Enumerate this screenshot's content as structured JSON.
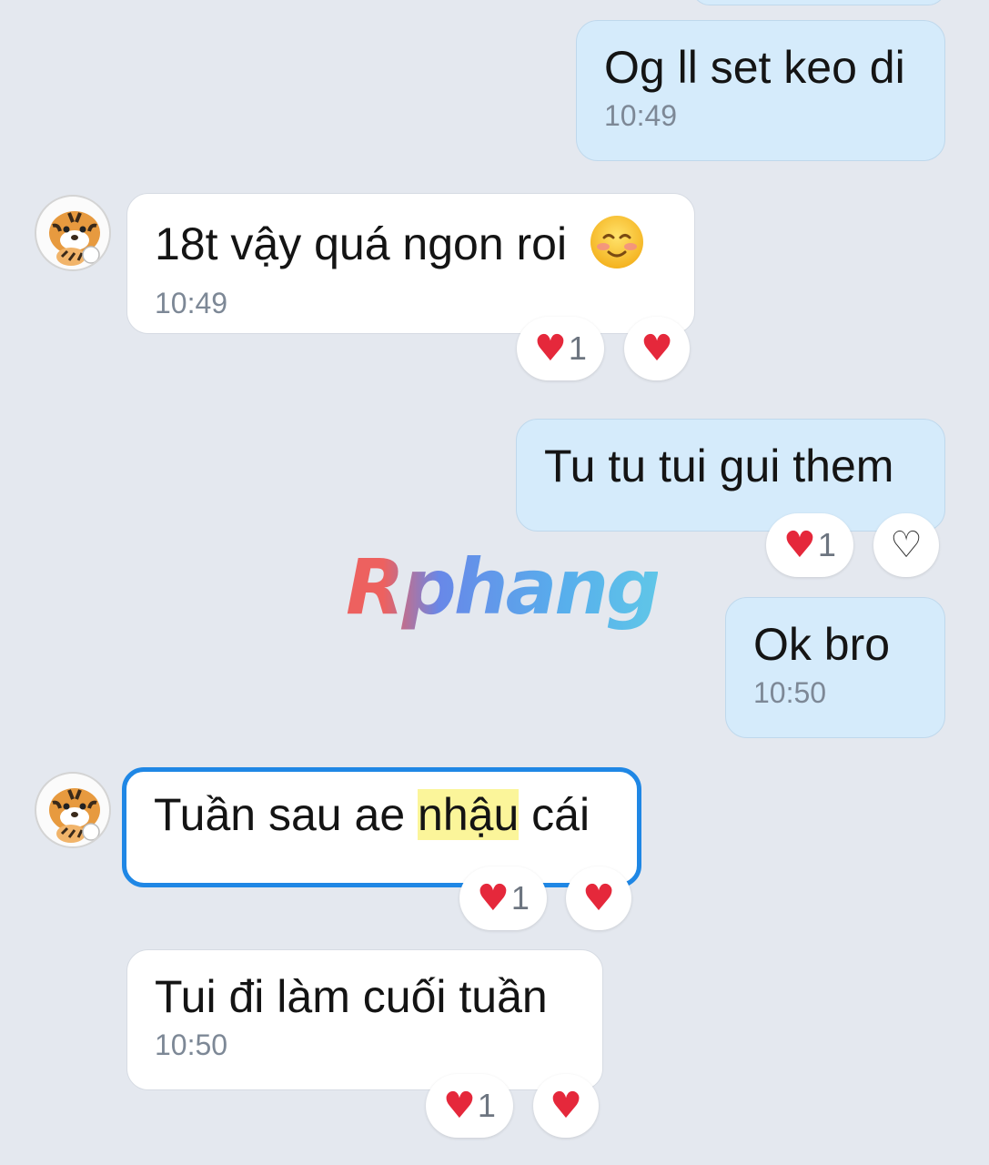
{
  "messages": [
    {
      "text": "Og ll set keo di",
      "time": "10:49"
    },
    {
      "text": "18t vậy quá ngon roi",
      "emoji": "☺",
      "time": "10:49",
      "reaction_count": "1"
    },
    {
      "text": "Tu tu tui gui them",
      "reaction_count": "1"
    },
    {
      "text": "Ok bro",
      "time": "10:50"
    },
    {
      "text_before": "Tuần sau ae ",
      "text_highlight": "nhậu",
      "text_after": " cái",
      "reaction_count": "1"
    },
    {
      "text": "Tui đi làm cuối tuần",
      "time": "10:50",
      "reaction_count": "1"
    }
  ],
  "watermark": "Rphang",
  "colors": {
    "background": "#e4e8ef",
    "outgoing_bubble": "#d5ebfb",
    "incoming_bubble": "#ffffff",
    "selected_border": "#1f87e5",
    "highlight": "#fbf59a",
    "heart": "#e5283b"
  },
  "icons": {
    "reaction": "heart-icon",
    "reaction_outline": "heart-outline-icon",
    "avatar": "tiger-avatar"
  }
}
